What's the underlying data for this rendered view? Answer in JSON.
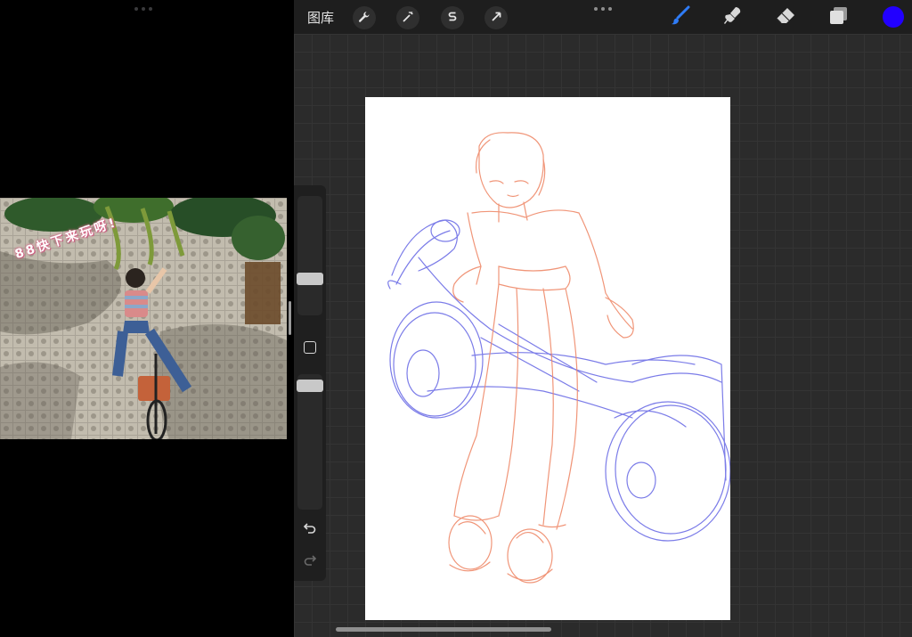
{
  "left_pane": {
    "photo": {
      "caption": "88快下来玩呀!"
    }
  },
  "topbar": {
    "gallery_label": "图库",
    "tools": [
      {
        "name": "actions",
        "icon": "wrench-icon"
      },
      {
        "name": "adjustments",
        "icon": "magic-wand-icon"
      },
      {
        "name": "selection",
        "icon": "selection-s-icon"
      },
      {
        "name": "transform",
        "icon": "arrow-cursor-icon"
      }
    ],
    "right_tools": [
      {
        "name": "brush",
        "icon": "brush-icon",
        "active": true
      },
      {
        "name": "smudge",
        "icon": "smudge-icon"
      },
      {
        "name": "eraser",
        "icon": "eraser-icon"
      },
      {
        "name": "layers",
        "icon": "layers-icon"
      }
    ],
    "current_color": "#2200ff",
    "accent_color": "#2f7cf6"
  },
  "sidebar": {
    "brush_size": 0.5,
    "opacity": 0.95,
    "undo_icon": "undo-icon",
    "redo_icon": "redo-icon"
  },
  "sketch": {
    "figure_color": "#ef8a6a",
    "motorcycle_color": "#6d6ee6"
  }
}
